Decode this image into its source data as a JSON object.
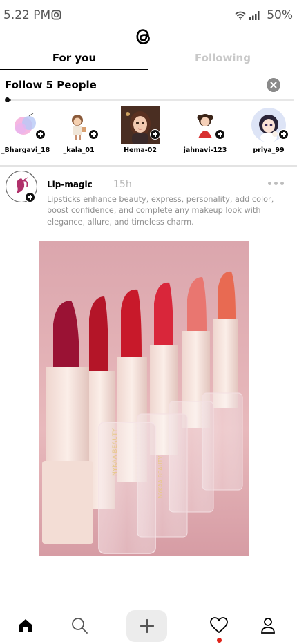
{
  "status_bar": {
    "time": "5.22 PM",
    "battery": "50%",
    "icons": [
      "instagram-icon",
      "wifi-icon",
      "signal-icon"
    ]
  },
  "app": {
    "logo_icon": "threads-logo"
  },
  "tabs": [
    {
      "label": "For you",
      "active": true
    },
    {
      "label": "Following",
      "active": false
    }
  ],
  "follow_section": {
    "title": "Follow 5 People",
    "progress": 0.02,
    "close_icon": "close-icon",
    "suggestions": [
      {
        "name": "_Bhargavi_18",
        "avatar": "watercolor-avatar"
      },
      {
        "name": "_kala_01",
        "avatar": "cartoon-girl-avatar"
      },
      {
        "name": "Hema-02",
        "avatar": "3d-girl-avatar"
      },
      {
        "name": "jahnavi-123",
        "avatar": "cartoon-girl-red-avatar"
      },
      {
        "name": "priya_99",
        "avatar": "anime-girl-avatar"
      }
    ]
  },
  "post": {
    "username": "Lip-magic",
    "time": "15h",
    "text": "Lipsticks enhance beauty, express, personality, add color, boost confidence, and complete any makeup look with elegance, allure, and timeless charm.",
    "image": "lipstick-row-photo",
    "brand_text": "NYKAA BEAUTY"
  },
  "bottom_nav": [
    {
      "name": "home",
      "icon": "home-icon",
      "active": true
    },
    {
      "name": "search",
      "icon": "search-icon"
    },
    {
      "name": "compose",
      "icon": "plus-icon"
    },
    {
      "name": "activity",
      "icon": "heart-icon",
      "has_notification": true
    },
    {
      "name": "profile",
      "icon": "profile-icon"
    }
  ],
  "colors": {
    "accent": "#000000",
    "inactive_tab": "#c9c9c9",
    "notification": "#e0241b",
    "secondary_text": "#8f8f8f"
  }
}
